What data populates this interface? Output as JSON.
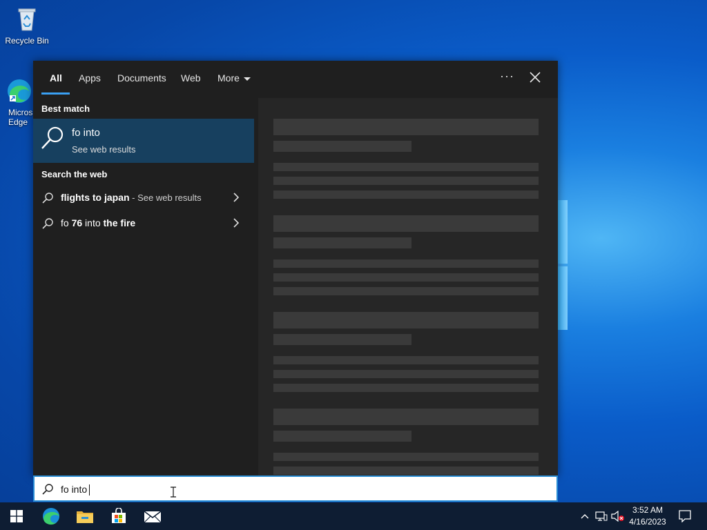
{
  "desktop": {
    "icons": [
      {
        "label": "Recycle Bin"
      },
      {
        "label": "Micros\nEdge"
      }
    ]
  },
  "search_panel": {
    "tabs": [
      {
        "label": "All",
        "active": true
      },
      {
        "label": "Apps"
      },
      {
        "label": "Documents"
      },
      {
        "label": "Web"
      },
      {
        "label": "More"
      }
    ],
    "options_label": "···",
    "best_match_header": "Best match",
    "best_match": {
      "title": "fo into",
      "subtitle": "See web results"
    },
    "search_web_header": "Search the web",
    "web_results": [
      {
        "bold": "flights to japan",
        "suffix": " - See web results"
      },
      {
        "prefix": "fo ",
        "bold1": "76",
        "middle": " into ",
        "bold2": "the fire"
      }
    ]
  },
  "search_box": {
    "value": "fo into"
  },
  "taskbar": {
    "apps": [
      "start-icon",
      "edge-icon",
      "file-explorer-icon",
      "store-icon",
      "mail-icon"
    ],
    "clock": {
      "time": "3:52 AM",
      "date": "4/16/2023"
    }
  },
  "colors": {
    "accent": "#3aa0f3",
    "selected_bg": "#17405f",
    "panel_bg": "#1f1f1f",
    "preview_bg": "#262626",
    "taskbar_bg": "#0e1d33"
  }
}
